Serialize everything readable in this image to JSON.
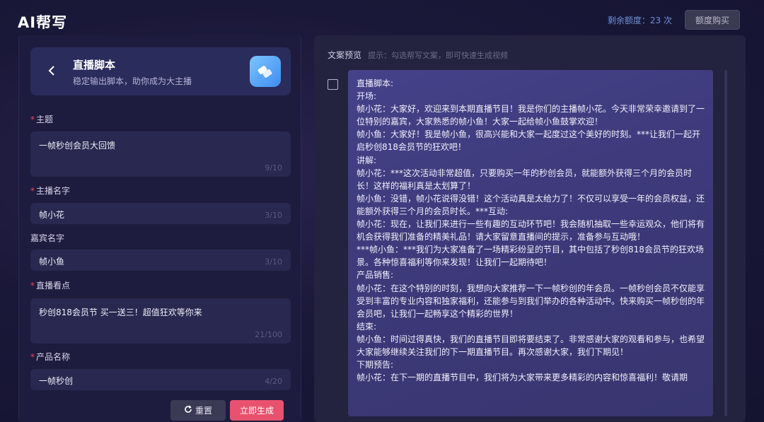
{
  "header": {
    "app_title": "AI帮写",
    "quota_text": "剩余额度：23 次",
    "buy_label": "额度购买"
  },
  "tool": {
    "title": "直播脚本",
    "subtitle": "稳定输出脚本，助你成为大主播"
  },
  "form": {
    "theme": {
      "label": "主题",
      "required": true,
      "value": "一帧秒创会员大回馈",
      "count": "9/10"
    },
    "host": {
      "label": "主播名字",
      "required": true,
      "value": "帧小花",
      "count": "3/10"
    },
    "guest": {
      "label": "嘉宾名字",
      "required": false,
      "value": "帧小鱼",
      "count": "3/10"
    },
    "highlight": {
      "label": "直播看点",
      "required": true,
      "value": "秒创818会员节 买一送三！超值狂欢等你来",
      "count": "21/100"
    },
    "product": {
      "label": "产品名称",
      "required": true,
      "value": "一帧秒创",
      "count": "4/20"
    },
    "required_mark": "*"
  },
  "actions": {
    "reset_label": "重置",
    "generate_label": "立即生成"
  },
  "preview": {
    "label": "文案预览",
    "hint": "提示：勾选帮写文案，即可快速生成视频",
    "content": "直播脚本:\n开场:\n帧小花：大家好，欢迎来到本期直播节目！我是你们的主播帧小花。今天非常荣幸邀请到了一位特别的嘉宾，大家熟悉的帧小鱼！大家一起给帧小鱼鼓掌欢迎！\n帧小鱼：大家好！我是帧小鱼，很高兴能和大家一起度过这个美好的时刻。***让我们一起开启秒创818会员节的狂欢吧！\n讲解:\n帧小花：***这次活动非常超值，只要购买一年的秒创会员，就能额外获得三个月的会员时长！这样的福利真是太划算了！\n帧小鱼：没错，帧小花说得没错！这个活动真是太给力了！不仅可以享受一年的会员权益，还能额外获得三个月的会员时长。***互动:\n帧小花：现在，让我们来进行一些有趣的互动环节吧！我会随机抽取一些幸运观众，他们将有机会获得我们准备的精美礼品！请大家留意直播间的提示，准备参与互动哦！\n***帧小鱼：***我们为大家准备了一场精彩纷呈的节目，其中包括了秒创818会员节的狂欢场景。各种惊喜福利等你来发现！让我们一起期待吧！\n产品销售:\n帧小花：在这个特别的时刻，我想向大家推荐一下一帧秒创的年会员。一帧秒创会员不仅能享受到丰富的专业内容和独家福利，还能参与到我们举办的各种活动中。快来购买一帧秒创的年会员吧，让我们一起畅享这个精彩的世界！\n结束:\n帧小鱼：时间过得真快，我们的直播节目即将要结束了。非常感谢大家的观看和参与，也希望大家能够继续关注我们的下一期直播节目。再次感谢大家，我们下期见！\n下期预告:\n帧小花：在下一期的直播节目中，我们将为大家带来更多精彩的内容和惊喜福利！敬请期"
  }
}
